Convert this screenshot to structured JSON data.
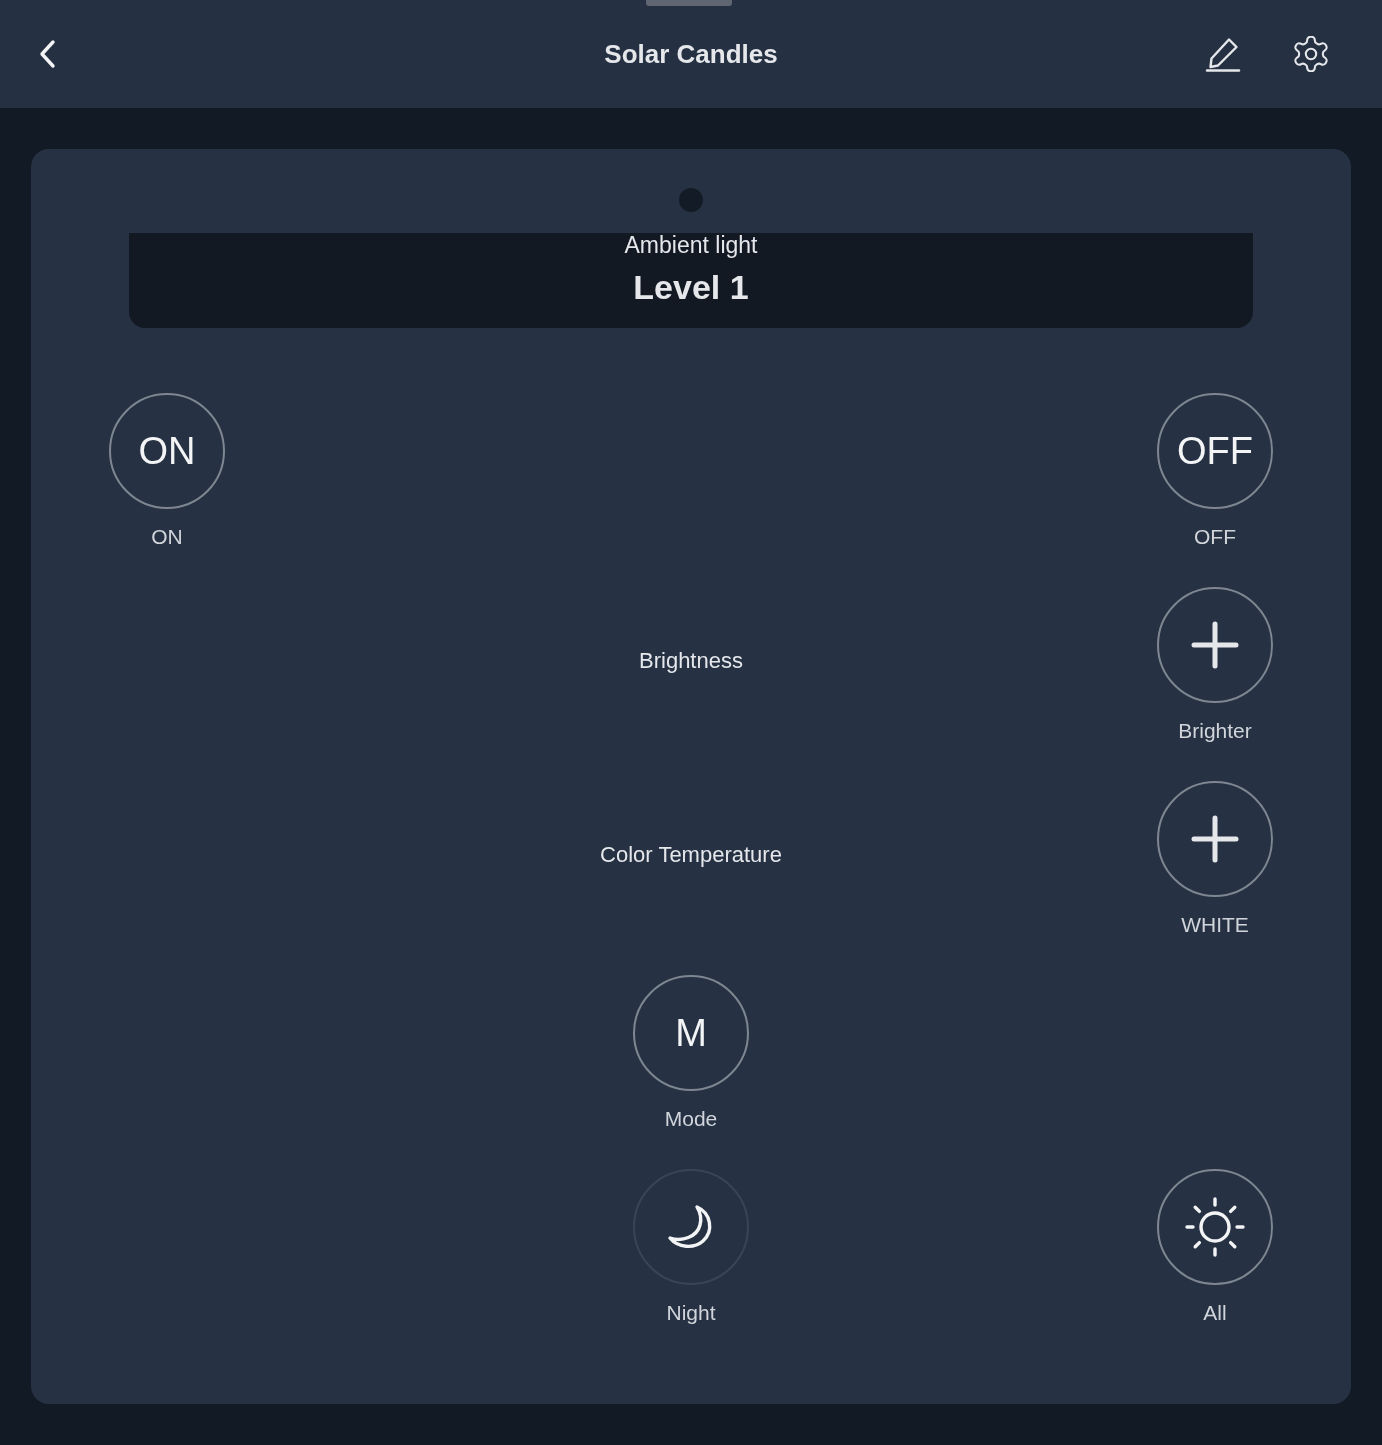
{
  "header": {
    "title": "Solar Candles"
  },
  "display": {
    "caption": "Ambient light",
    "value": "Level 1"
  },
  "rows": [
    {
      "left": {
        "kind": "glyph",
        "glyph": "ON",
        "label": "ON",
        "dimmed": false
      },
      "right": {
        "kind": "glyph",
        "glyph": "OFF",
        "label": "OFF",
        "dimmed": false
      }
    },
    {
      "center": {
        "kind": "caption",
        "label": "Brightness"
      },
      "right": {
        "kind": "plus",
        "label": "Brighter",
        "dimmed": false
      }
    },
    {
      "center": {
        "kind": "caption",
        "label": "Color Temperature"
      },
      "right": {
        "kind": "plus",
        "label": "WHITE",
        "dimmed": false
      }
    },
    {
      "center": {
        "kind": "glyph",
        "glyph": "M",
        "label": "Mode",
        "dimmed": false
      }
    },
    {
      "center": {
        "kind": "moon",
        "label": "Night",
        "dimmed": true
      },
      "right": {
        "kind": "sun",
        "label": "All",
        "dimmed": false
      }
    }
  ]
}
